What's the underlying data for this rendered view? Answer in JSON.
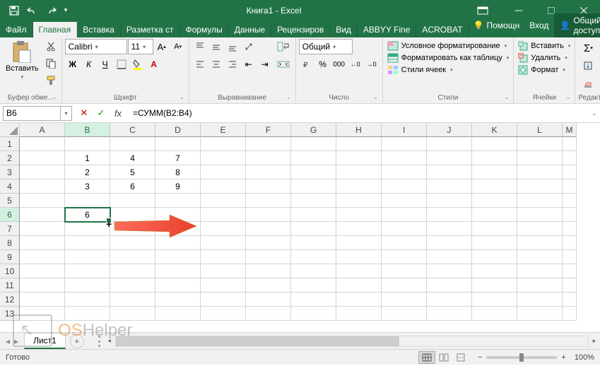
{
  "title": "Книга1 - Excel",
  "menu": {
    "file": "Файл",
    "tabs": [
      "Главная",
      "Вставка",
      "Разметка ст",
      "Формулы",
      "Данные",
      "Рецензиров",
      "Вид",
      "ABBYY Fine",
      "ACROBAT"
    ],
    "help": "Помощн",
    "signin": "Вход",
    "share": "Общий доступ"
  },
  "ribbon": {
    "clipboard": {
      "label": "Буфер обме...",
      "paste": "Вставить"
    },
    "font": {
      "label": "Шрифт",
      "name": "Calibri",
      "size": "11",
      "bold": "Ж",
      "italic": "К",
      "underline": "Ч"
    },
    "alignment": {
      "label": "Выравнивание"
    },
    "number": {
      "label": "Число",
      "format": "Общий"
    },
    "styles": {
      "label": "Стили",
      "conditional": "Условное форматирование",
      "table": "Форматировать как таблицу",
      "cell": "Стили ячеек"
    },
    "cells": {
      "label": "Ячейки",
      "insert": "Вставить",
      "delete": "Удалить",
      "format": "Формат"
    },
    "editing": {
      "label": "Редактиро..."
    }
  },
  "formula_bar": {
    "cell_ref": "B6",
    "fx_label": "fx",
    "formula": "=СУММ(B2:B4)"
  },
  "grid": {
    "cols": [
      "A",
      "B",
      "C",
      "D",
      "E",
      "F",
      "G",
      "H",
      "I",
      "J",
      "K",
      "L",
      "M"
    ],
    "rows": 13,
    "active_col": "B",
    "active_row": 6,
    "data": {
      "B2": "1",
      "C2": "4",
      "D2": "7",
      "B3": "2",
      "C3": "5",
      "D3": "8",
      "B4": "3",
      "C4": "6",
      "D4": "9",
      "B6": "6"
    }
  },
  "chart_data": {
    "type": "table",
    "note": "Spreadsheet cells; B6 computes =СУММ(B2:B4)",
    "columns": [
      "B",
      "C",
      "D"
    ],
    "rows": [
      {
        "B": 1,
        "C": 4,
        "D": 7
      },
      {
        "B": 2,
        "C": 5,
        "D": 8
      },
      {
        "B": 3,
        "C": 6,
        "D": 9
      }
    ],
    "computed": {
      "B6": 6
    }
  },
  "sheet": {
    "name": "Лист1"
  },
  "status": {
    "ready": "Готово",
    "zoom": "100%"
  },
  "watermark": {
    "os": "OS",
    "helper": "Helper"
  }
}
